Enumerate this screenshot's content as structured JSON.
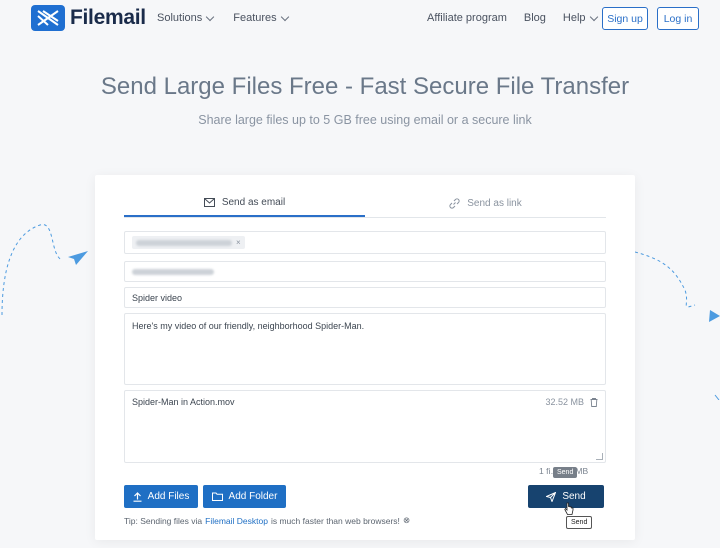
{
  "header": {
    "brand": "Filemail",
    "nav_left": [
      {
        "label": "Solutions"
      },
      {
        "label": "Features"
      }
    ],
    "nav_right": [
      {
        "label": "Affiliate program"
      },
      {
        "label": "Blog"
      },
      {
        "label": "Help"
      }
    ],
    "signup_label": "Sign up",
    "login_label": "Log in"
  },
  "hero": {
    "title": "Send Large Files Free - Fast Secure File Transfer",
    "subtitle": "Share large files up to 5 GB free using email or a secure link"
  },
  "tabs": [
    {
      "label": "Send as email",
      "icon": "envelope-icon",
      "active": true
    },
    {
      "label": "Send as link",
      "icon": "link-icon",
      "active": false
    }
  ],
  "form": {
    "recipient_remove": "×",
    "subject": "Spider video",
    "message": "Here's my video of our friendly, neighborhood Spider-Man.",
    "file": {
      "name": "Spider-Man in Action.mov",
      "size": "32.52 MB"
    },
    "summary": "1 fi… .52 MB"
  },
  "buttons": {
    "add_files": "Add Files",
    "add_folder": "Add Folder",
    "send": "Send"
  },
  "tooltips": {
    "send_top": "Send",
    "send_bottom": "Send"
  },
  "tip": {
    "prefix": "Tip: Sending files via",
    "link": "Filemail Desktop",
    "suffix": "is much faster than web browsers!",
    "close": "⊗"
  },
  "colors": {
    "brand": "#1f6fd1",
    "send_button": "#17436f",
    "accent": "#2a6fc8"
  }
}
